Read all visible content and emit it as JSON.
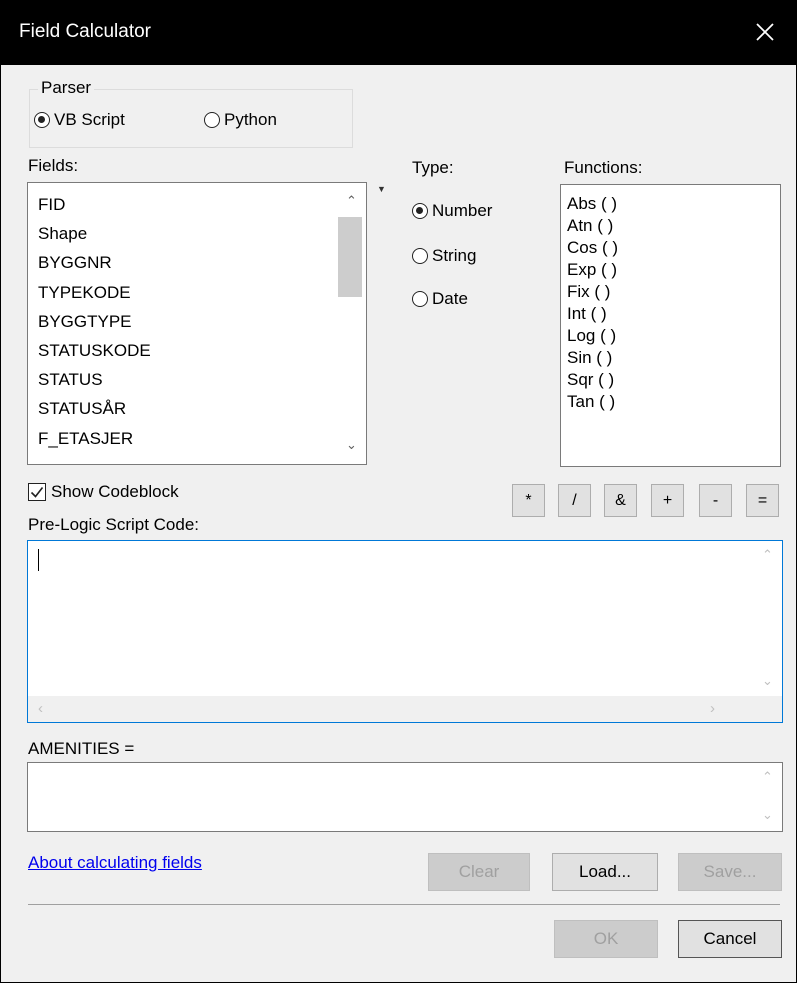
{
  "window": {
    "title": "Field Calculator"
  },
  "parser": {
    "legend": "Parser",
    "options": [
      {
        "label": "VB Script",
        "selected": true
      },
      {
        "label": "Python",
        "selected": false
      }
    ]
  },
  "fields": {
    "label": "Fields:",
    "items": [
      "FID",
      "Shape",
      "BYGGNR",
      "TYPEKODE",
      "BYGGTYPE",
      "STATUSKODE",
      "STATUS",
      "STATUSÅR",
      "F_ETASJER"
    ]
  },
  "type": {
    "label": "Type:",
    "options": [
      {
        "label": "Number",
        "selected": true
      },
      {
        "label": "String",
        "selected": false
      },
      {
        "label": "Date",
        "selected": false
      }
    ]
  },
  "functions": {
    "label": "Functions:",
    "items": [
      "Abs ( )",
      "Atn ( )",
      "Cos ( )",
      "Exp ( )",
      "Fix ( )",
      "Int ( )",
      "Log ( )",
      "Sin ( )",
      "Sqr ( )",
      "Tan ( )"
    ]
  },
  "codeblock": {
    "label": "Show Codeblock",
    "checked": true
  },
  "operators": [
    "*",
    "/",
    "&",
    "+",
    "-",
    "="
  ],
  "prelogic": {
    "label": "Pre-Logic Script Code:",
    "value": ""
  },
  "expression": {
    "label": "AMENITIES =",
    "value": ""
  },
  "help_link": "About calculating fields",
  "buttons": {
    "clear": "Clear",
    "load": "Load...",
    "save": "Save...",
    "ok": "OK",
    "cancel": "Cancel"
  },
  "colors": {
    "accent_border": "#0078d7",
    "link": "#0000ee",
    "titlebar": "#000000"
  }
}
